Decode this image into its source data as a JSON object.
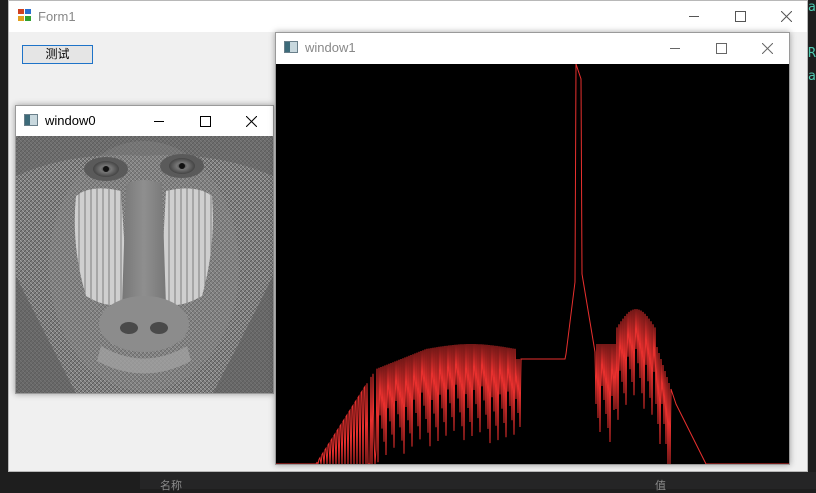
{
  "form": {
    "title": "Form1",
    "test_button": "测试"
  },
  "window0": {
    "title": "window0"
  },
  "window1": {
    "title": "window1"
  },
  "ide": {
    "code_chars": [
      "a",
      "R",
      "a"
    ],
    "bottom_left": "名称",
    "bottom_right": "值"
  },
  "colors": {
    "histogram": "#e8302e",
    "accent": "#1e73c8",
    "ide_text": "#4ec9b0"
  },
  "icons": [
    "app-icon",
    "window-icon",
    "minimize-icon",
    "maximize-icon",
    "close-icon"
  ]
}
